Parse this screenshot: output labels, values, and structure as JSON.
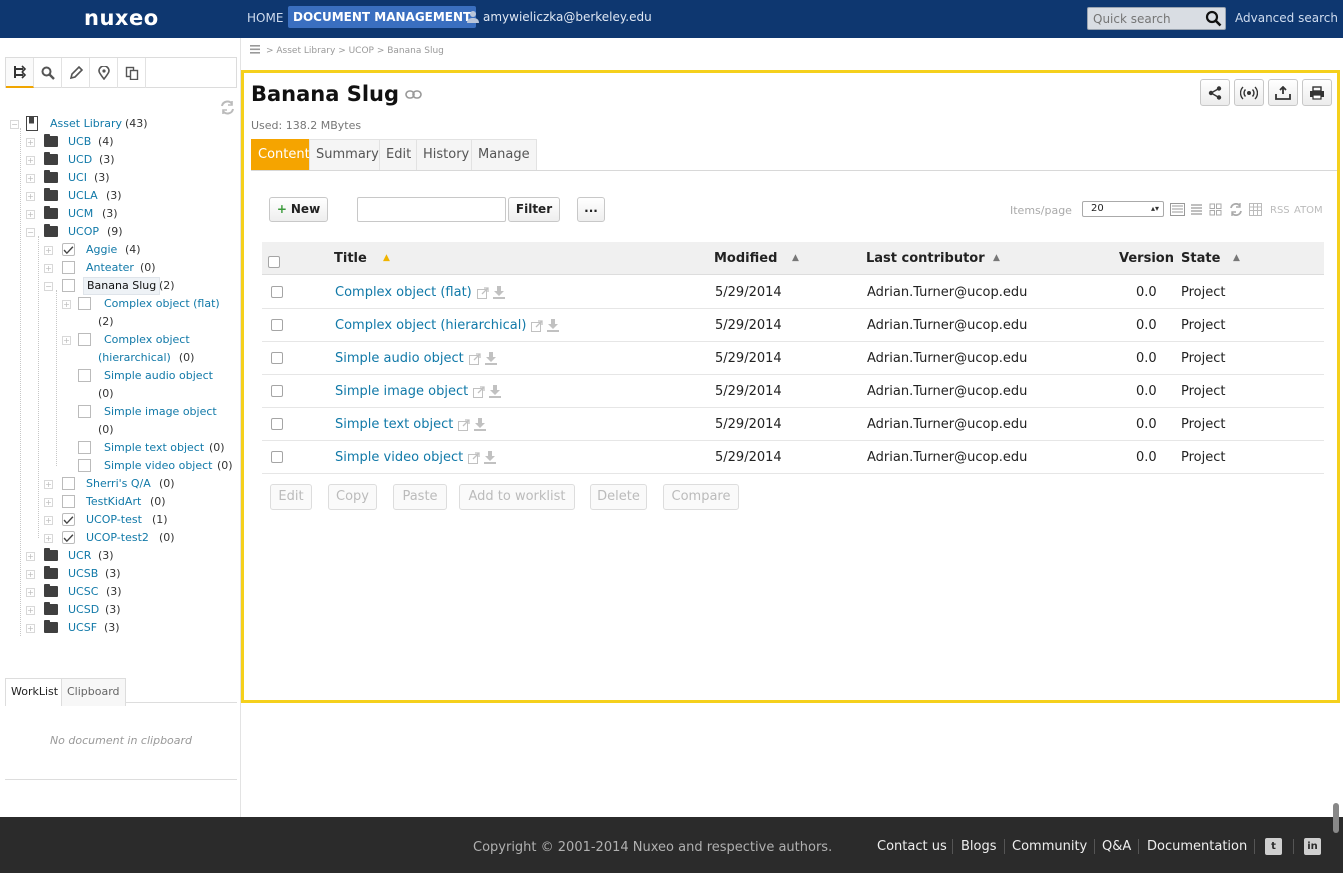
{
  "topbar": {
    "logo": "nuxeo",
    "home": "HOME",
    "document_management": "DOCUMENT MANAGEMENT",
    "user": "amywieliczka@berkeley.edu",
    "quick_search_placeholder": "Quick search",
    "advanced_search": "Advanced search"
  },
  "breadcrumb": "> Asset Library > UCOP > Banana Slug",
  "tree": {
    "root": {
      "label": "Asset Library",
      "count": "(43)"
    },
    "campuses_top": [
      {
        "label": "UCB",
        "count": "(4)"
      },
      {
        "label": "UCD",
        "count": "(3)"
      },
      {
        "label": "UCI",
        "count": "(3)"
      },
      {
        "label": "UCLA",
        "count": "(3)"
      },
      {
        "label": "UCM",
        "count": "(3)"
      },
      {
        "label": "UCOP",
        "count": "(9)"
      }
    ],
    "ucop_children": [
      {
        "label": "Aggie",
        "count": "(4)"
      },
      {
        "label": "Anteater",
        "count": "(0)"
      },
      {
        "label": "Banana Slug",
        "count": "(2)"
      }
    ],
    "slug_children": [
      {
        "label": "Complex object (flat)",
        "count": "(2)"
      },
      {
        "label_line1": "Complex object",
        "label_line2": "(hierarchical)",
        "count": "(0)"
      },
      {
        "label": "Simple audio object",
        "count": "(0)"
      },
      {
        "label": "Simple image object",
        "count": "(0)"
      },
      {
        "label": "Simple text object",
        "count": "(0)"
      },
      {
        "label": "Simple video object",
        "count": "(0)"
      }
    ],
    "ucop_children_after": [
      {
        "label": "Sherri's Q/A",
        "count": "(0)"
      },
      {
        "label": "TestKidArt",
        "count": "(0)"
      },
      {
        "label": "UCOP-test",
        "count": "(1)"
      },
      {
        "label": "UCOP-test2",
        "count": "(0)"
      }
    ],
    "campuses_bottom": [
      {
        "label": "UCR",
        "count": "(3)"
      },
      {
        "label": "UCSB",
        "count": "(3)"
      },
      {
        "label": "UCSC",
        "count": "(3)"
      },
      {
        "label": "UCSD",
        "count": "(3)"
      },
      {
        "label": "UCSF",
        "count": "(3)"
      }
    ]
  },
  "worklist": {
    "tabs": [
      "WorkList",
      "Clipboard"
    ],
    "empty": "No document in clipboard"
  },
  "main": {
    "title": "Banana Slug",
    "used": "Used: 138.2 MBytes",
    "tabs": [
      "Content",
      "Summary",
      "Edit",
      "History",
      "Manage"
    ],
    "new_label": "New",
    "filter_label": "Filter",
    "more_label": "...",
    "items_per_page_label": "Items/page",
    "items_per_page_value": "20",
    "rss": "RSS",
    "atom": "ATOM",
    "columns": {
      "title": "Title",
      "modified": "Modified",
      "contributor": "Last contributor",
      "version": "Version",
      "state": "State"
    },
    "rows": [
      {
        "title": "Complex object (flat)",
        "modified": "5/29/2014",
        "contributor": "Adrian.Turner@ucop.edu",
        "version": "0.0",
        "state": "Project"
      },
      {
        "title": "Complex object (hierarchical)",
        "modified": "5/29/2014",
        "contributor": "Adrian.Turner@ucop.edu",
        "version": "0.0",
        "state": "Project"
      },
      {
        "title": "Simple audio object",
        "modified": "5/29/2014",
        "contributor": "Adrian.Turner@ucop.edu",
        "version": "0.0",
        "state": "Project"
      },
      {
        "title": "Simple image object",
        "modified": "5/29/2014",
        "contributor": "Adrian.Turner@ucop.edu",
        "version": "0.0",
        "state": "Project"
      },
      {
        "title": "Simple text object",
        "modified": "5/29/2014",
        "contributor": "Adrian.Turner@ucop.edu",
        "version": "0.0",
        "state": "Project"
      },
      {
        "title": "Simple video object",
        "modified": "5/29/2014",
        "contributor": "Adrian.Turner@ucop.edu",
        "version": "0.0",
        "state": "Project"
      }
    ],
    "bulk_actions": [
      "Edit",
      "Copy",
      "Paste",
      "Add to worklist",
      "Delete",
      "Compare"
    ]
  },
  "footer": {
    "copyright": "Copyright © 2001-2014 Nuxeo and respective authors.",
    "links": [
      "Contact us",
      "Blogs",
      "Community",
      "Q&A",
      "Documentation"
    ],
    "social": [
      "twitter-icon",
      "linkedin-icon"
    ]
  }
}
